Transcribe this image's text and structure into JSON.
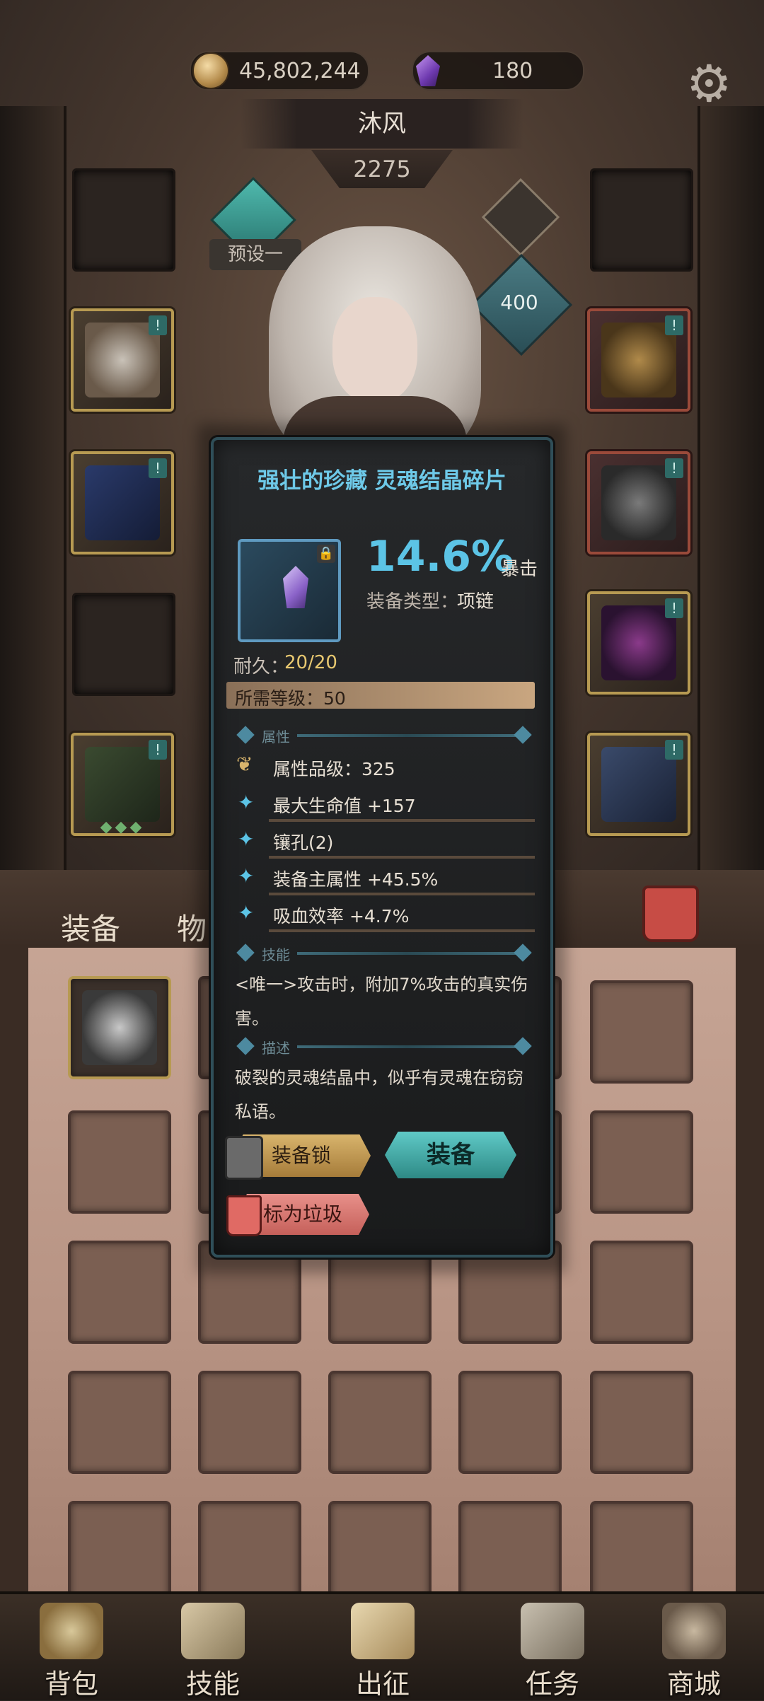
{
  "currency": {
    "gold": "45,802,244",
    "gems": "180"
  },
  "character": {
    "name": "沐风",
    "power": "2275",
    "level": "400",
    "preset_label": "预设一"
  },
  "tabs": {
    "equipment": "装备",
    "items": "物品"
  },
  "tooltip": {
    "title": "强壮的珍藏 灵魂结晶碎片",
    "main_value": "14.6%",
    "main_stat": "暴击",
    "equip_type_label": "装备类型：",
    "equip_type_value": "项链",
    "durability_label": "耐久：",
    "durability_value": "20/20",
    "required_level": "所需等级：50",
    "section_attributes": "属性",
    "attr_grade": "属性品级：325",
    "attrs": [
      "最大生命值 +157",
      "镶孔(2)",
      "装备主属性 +45.5%",
      "吸血效率 +4.7%"
    ],
    "section_skill": "技能",
    "skill_text": "<唯一>攻击时，附加7%攻击的真实伤害。",
    "section_desc": "描述",
    "desc_text": "破裂的灵魂结晶中，似乎有灵魂在窃窃私语。",
    "btn_lock": "装备锁",
    "btn_equip": "装备",
    "btn_trash": "标为垃圾"
  },
  "nav": [
    "背包",
    "技能",
    "出征",
    "任务",
    "商城"
  ],
  "colors": {
    "accent": "#5cc4e6",
    "gold_border": "#b79a52",
    "equip_button": "#3fa9a5"
  }
}
